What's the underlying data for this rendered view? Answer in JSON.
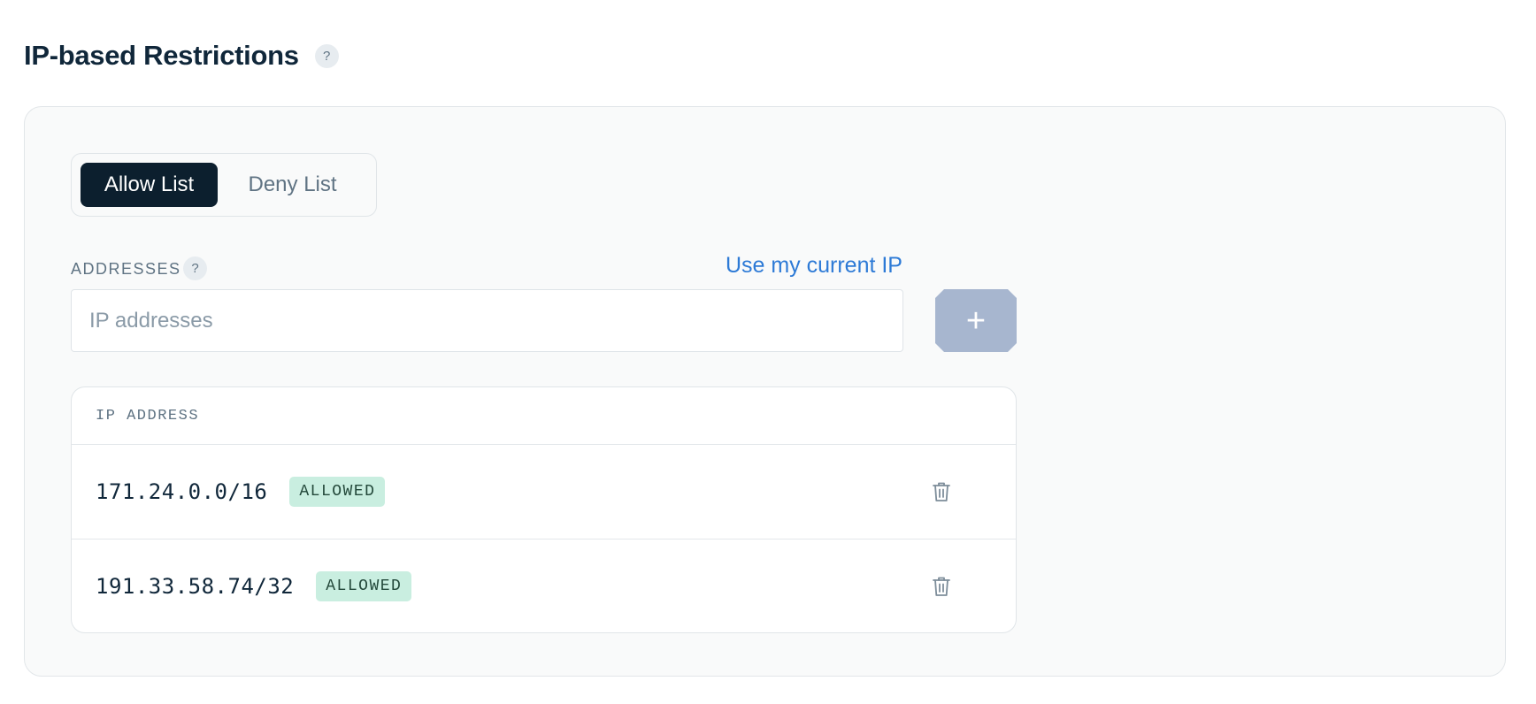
{
  "header": {
    "title": "IP-based Restrictions",
    "help": "?"
  },
  "tabs": {
    "allow": "Allow List",
    "deny": "Deny List",
    "selected": "Allow List"
  },
  "addresses": {
    "label": "ADDRESSES",
    "help": "?",
    "use_current_ip": "Use my current IP",
    "input_placeholder": "IP addresses",
    "input_value": "",
    "add_icon": "plus-icon"
  },
  "table": {
    "column_header": "IP ADDRESS",
    "rows": [
      {
        "ip": "171.24.0.0/16",
        "status": "ALLOWED",
        "action_icon": "trash-icon"
      },
      {
        "ip": "191.33.58.74/32",
        "status": "ALLOWED",
        "action_icon": "trash-icon"
      }
    ]
  },
  "colors": {
    "primary_dark": "#0c1f2e",
    "link": "#2d7ad6",
    "add_button": "#a7b6cf",
    "badge_bg": "#c9eee0",
    "badge_text": "#23483a"
  }
}
